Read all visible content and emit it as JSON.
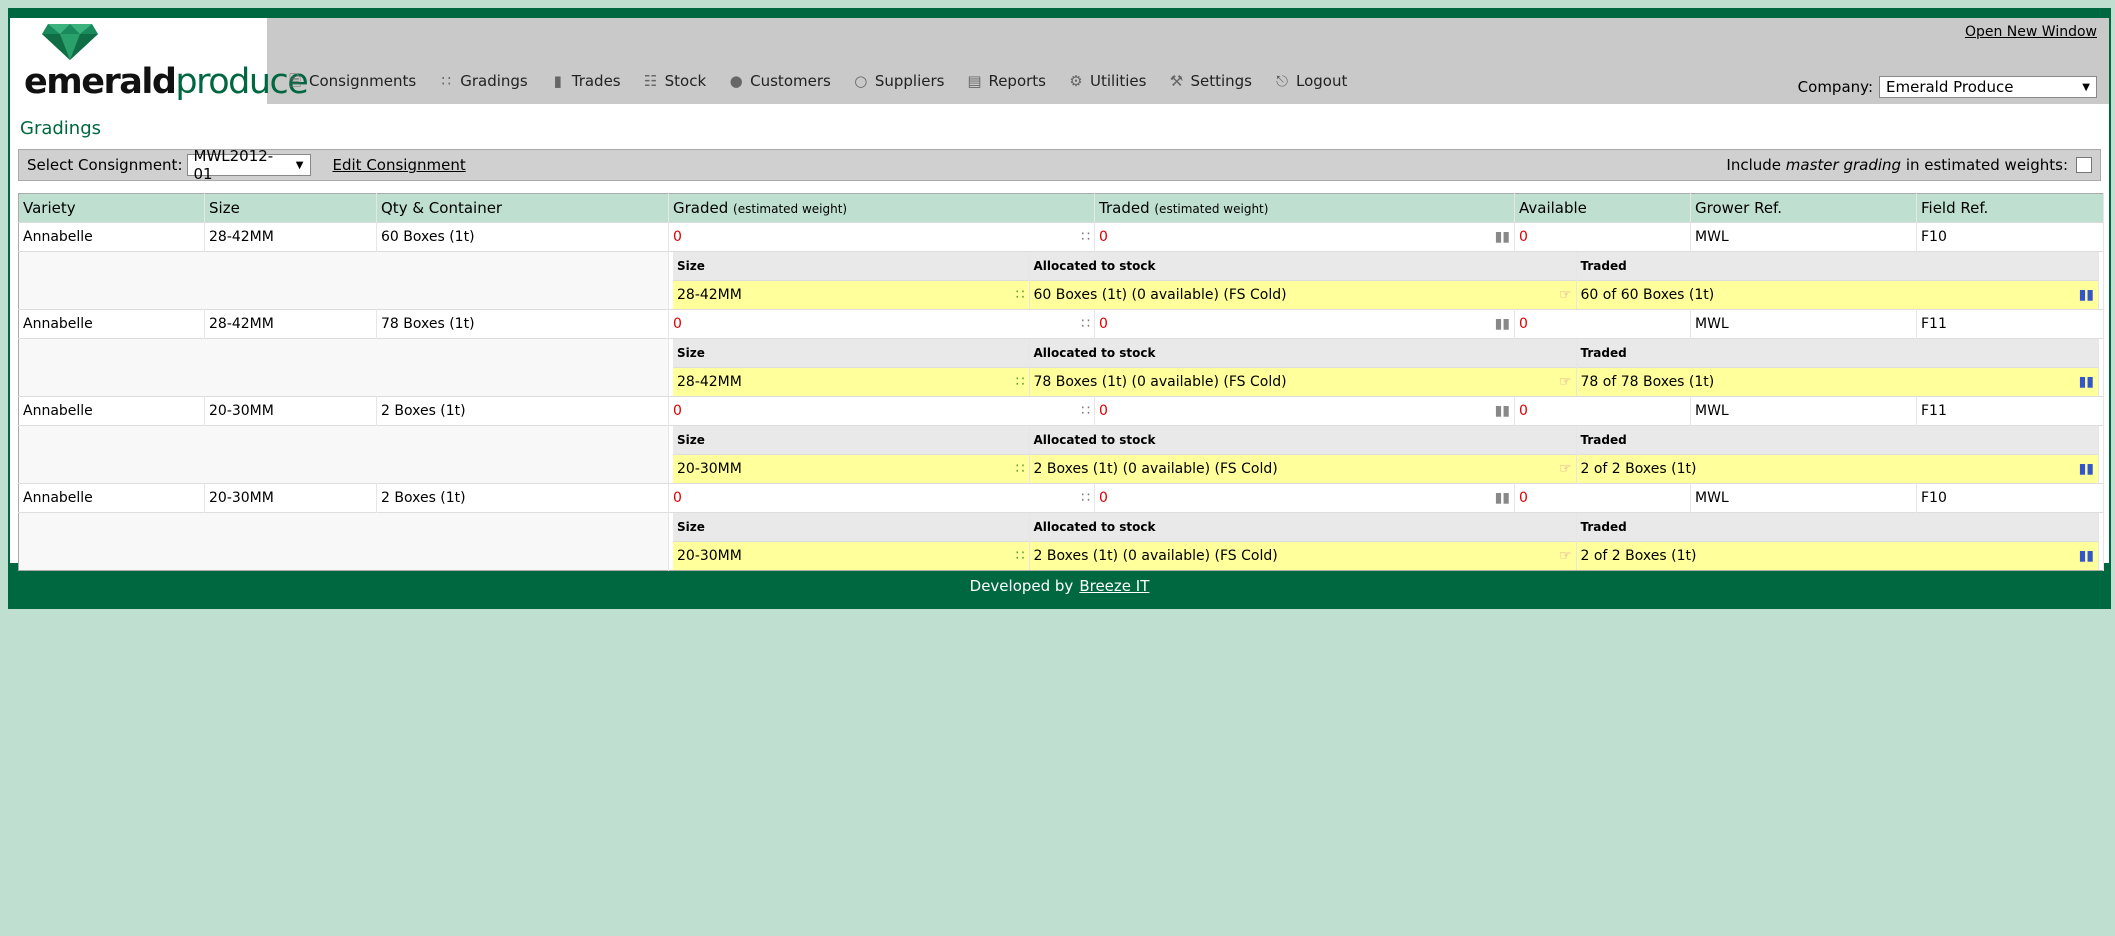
{
  "header": {
    "logo_word_1": "emerald",
    "logo_word_2": "produce",
    "open_new_window": "Open New Window",
    "company_label": "Company:",
    "company_value": "Emerald Produce"
  },
  "nav": {
    "items": [
      {
        "label": "Consignments",
        "icon": "document-icon"
      },
      {
        "label": "Gradings",
        "icon": "hierarchy-icon"
      },
      {
        "label": "Trades",
        "icon": "bar-chart-icon"
      },
      {
        "label": "Stock",
        "icon": "cart-icon"
      },
      {
        "label": "Customers",
        "icon": "person-icon"
      },
      {
        "label": "Suppliers",
        "icon": "person-outline-icon"
      },
      {
        "label": "Reports",
        "icon": "report-icon"
      },
      {
        "label": "Utilities",
        "icon": "gear-icon"
      },
      {
        "label": "Settings",
        "icon": "wrench-icon"
      },
      {
        "label": "Logout",
        "icon": "logout-icon"
      }
    ]
  },
  "page": {
    "title": "Gradings"
  },
  "filter": {
    "select_label": "Select Consignment:",
    "consignment_value": "MWL2012-01",
    "edit_link": "Edit Consignment",
    "include_label_pre": "Include ",
    "include_label_em": "master grading",
    "include_label_post": " in estimated weights:",
    "include_checked": false
  },
  "table": {
    "headers": {
      "variety": "Variety",
      "size": "Size",
      "qty": "Qty & Container",
      "graded": "Graded",
      "graded_note": "(estimated weight)",
      "traded": "Traded",
      "traded_note": "(estimated weight)",
      "available": "Available",
      "grower": "Grower Ref.",
      "field": "Field Ref."
    },
    "sub_headers": {
      "size": "Size",
      "allocated": "Allocated to stock",
      "traded": "Traded"
    },
    "rows": [
      {
        "variety": "Annabelle",
        "size": "28-42MM",
        "qty": "60 Boxes (1t)",
        "graded": "0",
        "traded": "0",
        "available": "0",
        "grower": "MWL",
        "field": "F10",
        "sub": {
          "size": "28-42MM",
          "allocated": "60 Boxes (1t) (0 available) (FS Cold)",
          "traded": "60 of 60 Boxes (1t)"
        }
      },
      {
        "variety": "Annabelle",
        "size": "28-42MM",
        "qty": "78 Boxes (1t)",
        "graded": "0",
        "traded": "0",
        "available": "0",
        "grower": "MWL",
        "field": "F11",
        "sub": {
          "size": "28-42MM",
          "allocated": "78 Boxes (1t) (0 available) (FS Cold)",
          "traded": "78 of 78 Boxes (1t)"
        }
      },
      {
        "variety": "Annabelle",
        "size": "20-30MM",
        "qty": "2 Boxes (1t)",
        "graded": "0",
        "traded": "0",
        "available": "0",
        "grower": "MWL",
        "field": "F11",
        "sub": {
          "size": "20-30MM",
          "allocated": "2 Boxes (1t) (0 available) (FS Cold)",
          "traded": "2 of 2 Boxes (1t)"
        }
      },
      {
        "variety": "Annabelle",
        "size": "20-30MM",
        "qty": "2 Boxes (1t)",
        "graded": "0",
        "traded": "0",
        "available": "0",
        "grower": "MWL",
        "field": "F10",
        "sub": {
          "size": "20-30MM",
          "allocated": "2 Boxes (1t) (0 available) (FS Cold)",
          "traded": "2 of 2 Boxes (1t)"
        }
      }
    ]
  },
  "footer": {
    "developed_by": "Developed by",
    "link": "Breeze IT"
  },
  "colors": {
    "brand_green": "#006841",
    "header_grey": "#c9c9c9",
    "table_header": "#bfe0d1",
    "highlight_yellow": "#ffff9c",
    "value_red": "#dd0000"
  }
}
